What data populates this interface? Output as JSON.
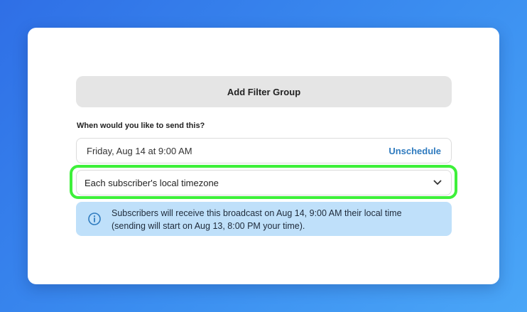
{
  "filters": {
    "add_group_label": "Add Filter Group"
  },
  "schedule": {
    "question": "When would you like to send this?",
    "date_value": "Friday, Aug 14 at 9:00 AM",
    "unschedule_label": "Unschedule",
    "timezone_selected": "Each subscriber's local timezone",
    "info_line1": "Subscribers will receive this broadcast on Aug 14, 9:00 AM their local time",
    "info_line2": "(sending will start on Aug 13, 8:00 PM your time)."
  },
  "icons": {
    "dropdown": "chevron-down-icon",
    "info": "info-circle-icon"
  },
  "colors": {
    "highlight": "#3ef03a",
    "link": "#2f7bbf",
    "info_background": "#bfe0fa",
    "info_icon": "#2f7bbf"
  }
}
